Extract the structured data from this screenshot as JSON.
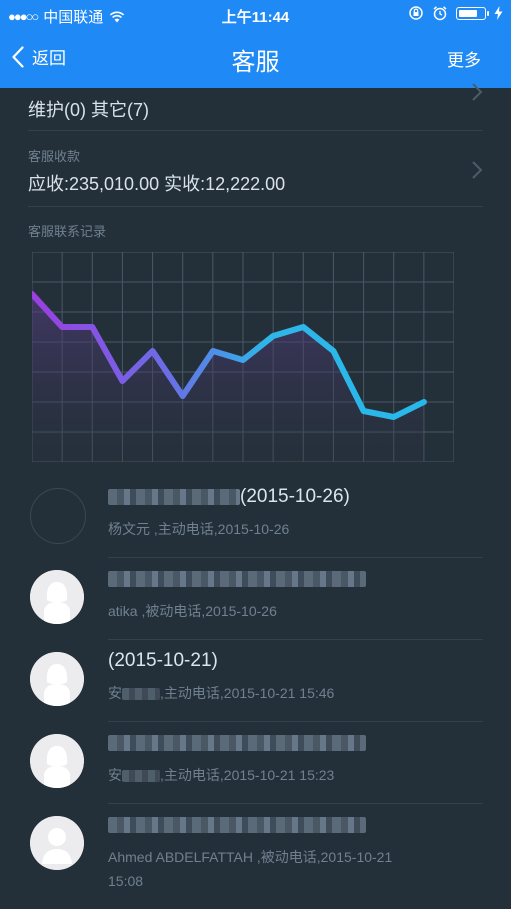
{
  "status_bar": {
    "signal": "●●●○○",
    "carrier": "中国联通",
    "time": "上午11:44",
    "battery_level": 0.8
  },
  "nav": {
    "back_label": "返回",
    "title": "客服",
    "more_label": "更多"
  },
  "summary": {
    "maintenance_text": "维护(0) 其它(7)",
    "collection_label": "客服收款",
    "collection_text": "应收:235,010.00 实收:12,222.00"
  },
  "chart_label": "客服联系记录",
  "chart_data": {
    "type": "line",
    "title": "",
    "xlabel": "",
    "ylabel": "",
    "x": [
      0,
      1,
      2,
      3,
      4,
      5,
      6,
      7,
      8,
      9,
      10,
      11,
      12,
      13,
      14
    ],
    "y": [
      5.6,
      4.5,
      4.5,
      2.7,
      3.7,
      2.2,
      3.7,
      3.4,
      4.2,
      4.5,
      3.7,
      1.7,
      1.5,
      2.0,
      null
    ],
    "ylim": [
      0,
      7
    ],
    "grid": true,
    "gradient_colors": [
      "#9b3fe0",
      "#6a6ee6",
      "#2fb6e8",
      "#27b8ea"
    ]
  },
  "contacts": [
    {
      "title_suffix": "(2015-10-26)",
      "subtitle": "杨文元 ,主动电话,2015-10-26",
      "avatar": "none"
    },
    {
      "title_suffix": "",
      "subtitle": "atika ,被动电话,2015-10-26",
      "avatar": "female"
    },
    {
      "title_suffix": "(2015-10-21)",
      "subtitle_prefix": "安",
      "subtitle": ",主动电话,2015-10-21 15:46",
      "avatar": "female"
    },
    {
      "title_suffix": "",
      "subtitle_prefix": "安",
      "subtitle": ",主动电话,2015-10-21 15:23",
      "avatar": "female"
    },
    {
      "title_suffix": "",
      "subtitle": "Ahmed ABDELFATTAH ,被动电话,2015-10-21",
      "subtitle_line2": "15:08",
      "avatar": "male"
    }
  ]
}
